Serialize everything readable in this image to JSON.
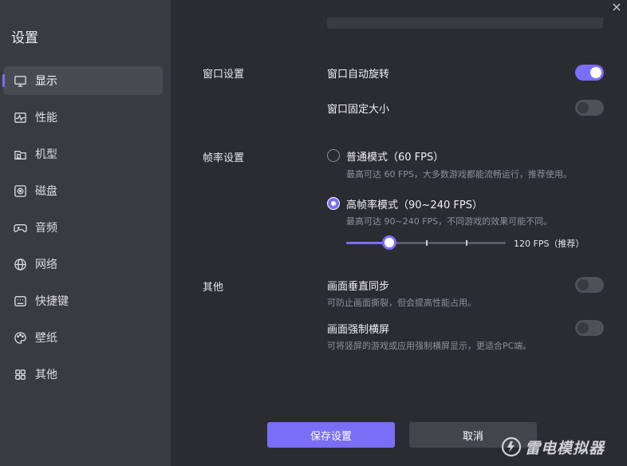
{
  "sidebar": {
    "title": "设置",
    "items": [
      {
        "label": "显示",
        "icon": "monitor-icon",
        "active": true
      },
      {
        "label": "性能",
        "icon": "pulse-icon"
      },
      {
        "label": "机型",
        "icon": "phone-icon"
      },
      {
        "label": "磁盘",
        "icon": "disk-icon"
      },
      {
        "label": "音频",
        "icon": "gamepad-icon"
      },
      {
        "label": "网络",
        "icon": "globe-icon"
      },
      {
        "label": "快捷键",
        "icon": "keyboard-icon"
      },
      {
        "label": "壁纸",
        "icon": "palette-icon"
      },
      {
        "label": "其他",
        "icon": "grid-icon"
      }
    ]
  },
  "window": {
    "close_glyph": "×"
  },
  "window_settings": {
    "section": "窗口设置",
    "auto_rotate": {
      "label": "窗口自动旋转",
      "on": true
    },
    "fixed_size": {
      "label": "窗口固定大小",
      "on": false
    }
  },
  "fps_settings": {
    "section": "帧率设置",
    "normal": {
      "label": "普通模式（60 FPS）",
      "desc": "最高可达 60 FPS，大多数游戏都能流畅运行，推荐使用。",
      "checked": false
    },
    "high": {
      "label": "高帧率模式（90~240 FPS）",
      "desc": "最高可达 90~240 FPS，不同游戏的效果可能不同。",
      "checked": true
    },
    "slider": {
      "value_label": "120 FPS（推荐）",
      "level": 0.27
    }
  },
  "other": {
    "section": "其他",
    "vsync": {
      "label": "画面垂直同步",
      "desc": "可防止画面撕裂，但会提高性能占用。",
      "on": false
    },
    "force_landscape": {
      "label": "画面强制横屏",
      "desc": "可将竖屏的游戏或应用强制横屏显示，更适合PC端。",
      "on": false
    }
  },
  "buttons": {
    "save": "保存设置",
    "cancel": "取消"
  },
  "brand": {
    "name": "雷电模拟器"
  },
  "colors": {
    "accent": "#7b6ef6",
    "sidebar_bg": "#3a3b41",
    "main_bg": "#2b2c32"
  }
}
